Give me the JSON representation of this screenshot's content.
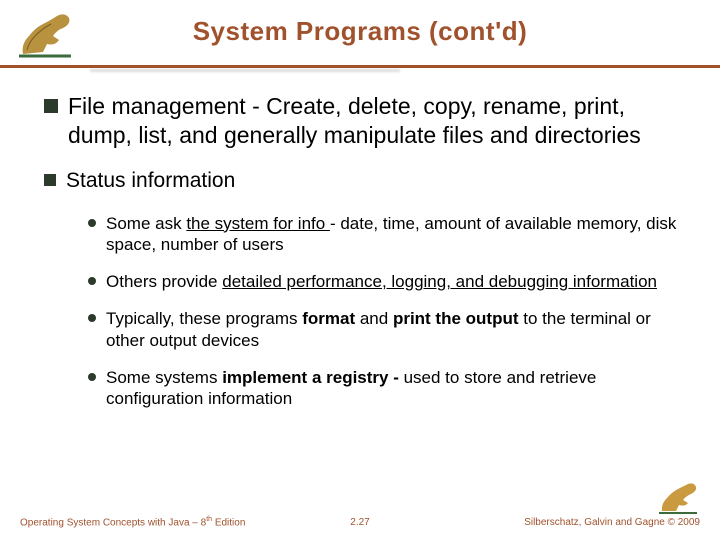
{
  "title": "System Programs (cont'd)",
  "bullets": {
    "b1": "File management - Create, delete, copy, rename, print, dump, list, and generally manipulate files and directories",
    "b2": "Status information",
    "s1a": "Some ask ",
    "s1u": "the system for info ",
    "s1b": "- date, time, amount of available memory, disk space, number of users",
    "s2a": "Others provide ",
    "s2u": "detailed performance, logging, and debugging information",
    "s3a": "Typically, these programs ",
    "s3b1": "format",
    "s3c": " and ",
    "s3b2": "print the output",
    "s3d": " to the terminal or other output devices",
    "s4a": "Some systems ",
    "s4b1": "implement  a registry - ",
    "s4b": "used to store and retrieve configuration information"
  },
  "footer": {
    "left_a": "Operating System Concepts  with Java – 8",
    "left_sup": "th",
    "left_b": " Edition",
    "center": "2.27",
    "right": "Silberschatz, Galvin and Gagne © 2009"
  }
}
